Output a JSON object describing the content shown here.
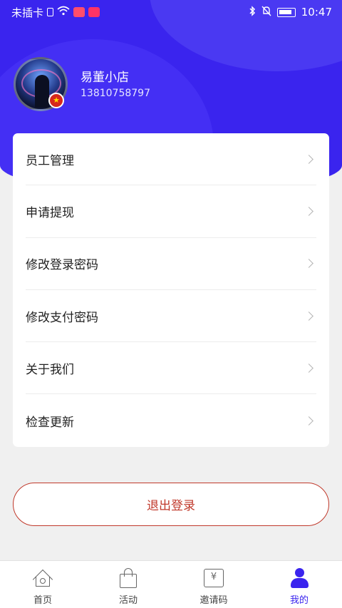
{
  "status_bar": {
    "carrier": "未插卡",
    "time": "10:47",
    "icons": [
      "sim-icon",
      "wifi-icon",
      "app-badge-icon",
      "message-badge-icon",
      "bluetooth-icon",
      "mute-icon",
      "battery-icon"
    ]
  },
  "profile": {
    "shop_name": "易董小店",
    "phone": "13810758797",
    "flag_glyph": "★"
  },
  "menu": {
    "items": [
      {
        "label": "员工管理"
      },
      {
        "label": "申请提现"
      },
      {
        "label": "修改登录密码"
      },
      {
        "label": "修改支付密码"
      },
      {
        "label": "关于我们"
      },
      {
        "label": "检查更新"
      }
    ]
  },
  "logout": {
    "label": "退出登录"
  },
  "tabbar": {
    "tabs": [
      {
        "label": "首页",
        "icon": "home-icon"
      },
      {
        "label": "活动",
        "icon": "bag-icon"
      },
      {
        "label": "邀请码",
        "icon": "ticket-icon",
        "glyph": "¥"
      },
      {
        "label": "我的",
        "icon": "user-icon",
        "active": true
      }
    ]
  },
  "colors": {
    "brand": "#3a24ee",
    "logout": "#c0392b",
    "background": "#f0f0f0"
  }
}
